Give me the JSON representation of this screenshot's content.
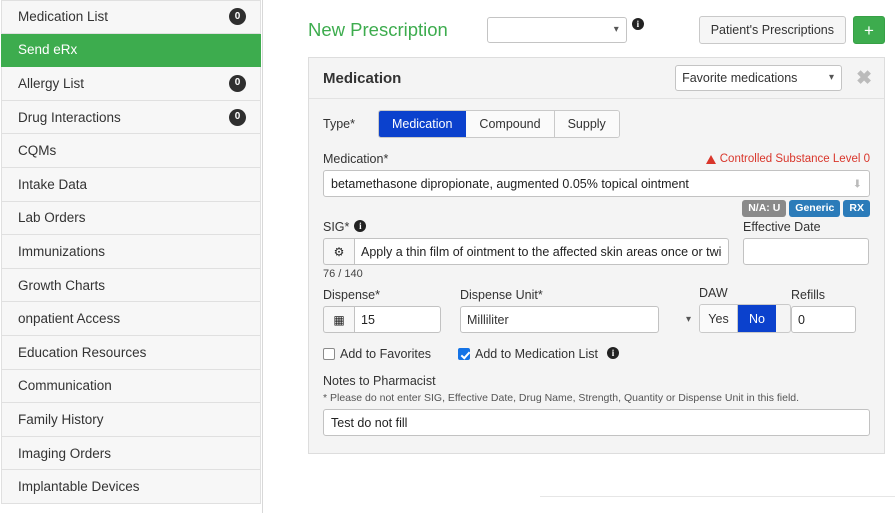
{
  "sidebar": {
    "items": [
      {
        "label": "Medication List",
        "badge": "0",
        "active": false
      },
      {
        "label": "Send eRx",
        "badge": "",
        "active": true
      },
      {
        "label": "Allergy List",
        "badge": "0",
        "active": false
      },
      {
        "label": "Drug Interactions",
        "badge": "0",
        "active": false
      },
      {
        "label": "CQMs",
        "badge": "",
        "active": false
      },
      {
        "label": "Intake Data",
        "badge": "",
        "active": false
      },
      {
        "label": "Lab Orders",
        "badge": "",
        "active": false
      },
      {
        "label": "Immunizations",
        "badge": "",
        "active": false
      },
      {
        "label": "Growth Charts",
        "badge": "",
        "active": false
      },
      {
        "label": "onpatient Access",
        "badge": "",
        "active": false
      },
      {
        "label": "Education Resources",
        "badge": "",
        "active": false
      },
      {
        "label": "Communication",
        "badge": "",
        "active": false
      },
      {
        "label": "Family History",
        "badge": "",
        "active": false
      },
      {
        "label": "Imaging Orders",
        "badge": "",
        "active": false
      },
      {
        "label": "Implantable Devices",
        "badge": "",
        "active": false
      }
    ]
  },
  "header": {
    "title": "New Prescription",
    "pharmacy_select_value": "",
    "pharmacy_select_placeholder": "",
    "info_glyph": "i",
    "patients_prescriptions_label": "Patient's Prescriptions",
    "add_label": "+"
  },
  "card": {
    "title": "Medication",
    "favorites_select_value": "Favorite medications",
    "close_glyph": "✖",
    "type": {
      "label": "Type*",
      "options": [
        "Medication",
        "Compound",
        "Supply"
      ],
      "selected": "Medication"
    },
    "medication": {
      "label": "Medication*",
      "warning": "Controlled Substance Level 0",
      "value": "betamethasone dipropionate, augmented 0.05% topical ointment",
      "caret_glyph": "⬇",
      "badges": [
        {
          "text": "N/A: U",
          "color": "#8a8a8a"
        },
        {
          "text": "Generic",
          "color": "#2b7bb9"
        },
        {
          "text": "RX",
          "color": "#2b7bb9"
        }
      ]
    },
    "sig": {
      "label": "SIG*",
      "info_glyph": "i",
      "gear_glyph": "⚙",
      "value": "Apply a thin film of ointment to the affected skin areas once or twice daily.",
      "counter": "76 / 140"
    },
    "effective_date": {
      "label": "Effective Date",
      "value": ""
    },
    "dispense": {
      "label": "Dispense*",
      "calc_glyph": "▦",
      "value": "15"
    },
    "dispense_unit": {
      "label": "Dispense Unit*",
      "value": "Milliliter"
    },
    "daw": {
      "label": "DAW",
      "options": [
        "Yes",
        "No"
      ],
      "selected": "No"
    },
    "refills": {
      "label": "Refills",
      "value": "0"
    },
    "checkboxes": [
      {
        "label": "Add to Favorites",
        "checked": false,
        "info": false
      },
      {
        "label": "Add to Medication List",
        "checked": true,
        "info": true
      }
    ],
    "notes": {
      "label": "Notes to Pharmacist",
      "hint": "* Please do not enter SIG, Effective Date, Drug Name, Strength, Quantity or Dispense Unit in this field.",
      "value": "Test do not fill"
    }
  },
  "colors": {
    "brand_green": "#3dac4e",
    "accent_blue": "#0b41cd",
    "warning_red": "#d9362b",
    "badge_blue": "#2b7bb9",
    "badge_gray": "#8a8a8a"
  }
}
